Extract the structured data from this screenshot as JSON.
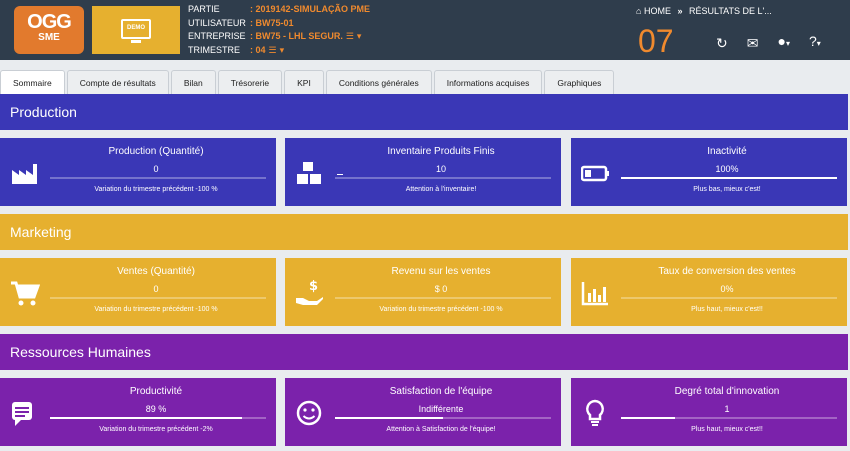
{
  "header": {
    "logo_line1": "OGG",
    "logo_line2": "SME",
    "demo_label": "DEMO",
    "rows": [
      {
        "label": "PARTIE",
        "value": ": 2019142-SIMULAÇÃO PME"
      },
      {
        "label": "UTILISATEUR",
        "value": ": BW75-01"
      },
      {
        "label": "ENTREPRISE",
        "value": ": BW75 - LHL SEGUR."
      },
      {
        "label": "TRIMESTRE",
        "value": ": 04"
      }
    ],
    "breadcrumb_home": "HOME",
    "breadcrumb_sep": "»",
    "breadcrumb_current": "RÉSULTATS DE L'...",
    "quarter_number": "07"
  },
  "tabs": [
    "Sommaire",
    "Compte de résultats",
    "Bilan",
    "Trésorerie",
    "KPI",
    "Conditions générales",
    "Informations acquises",
    "Graphiques"
  ],
  "colors": {
    "production": "#3a37b6",
    "marketing": "#e6b02f",
    "rh": "#7b22ab",
    "accent": "#f08a2e"
  },
  "sections": [
    {
      "title": "Production",
      "cards": [
        {
          "icon": "factory-icon",
          "title": "Production (Quantité)",
          "value": "0",
          "note": "Variation du trimestre précédent -100 %",
          "progress": 0
        },
        {
          "icon": "boxes-icon",
          "title": "Inventaire Produits Finis",
          "value": "10",
          "note": "Attention à l'inventaire!",
          "progress": 0
        },
        {
          "icon": "battery-icon",
          "title": "Inactivité",
          "value": "100%",
          "note": "Plus bas, mieux c'est!",
          "progress": 1.0
        }
      ]
    },
    {
      "title": "Marketing",
      "cards": [
        {
          "icon": "cart-icon",
          "title": "Ventes (Quantité)",
          "value": "0",
          "note": "Variation du trimestre précédent -100 %",
          "progress": 0
        },
        {
          "icon": "money-hand-icon",
          "title": "Revenu sur les ventes",
          "value": "$ 0",
          "note": "Variation du trimestre précédent -100 %",
          "progress": 0
        },
        {
          "icon": "bar-chart-icon",
          "title": "Taux de conversion des ventes",
          "value": "0%",
          "note": "Plus haut, mieux c'est!!",
          "progress": 0
        }
      ]
    },
    {
      "title": "Ressources Humaines",
      "cards": [
        {
          "icon": "comments-icon",
          "title": "Productivité",
          "value": "89 %",
          "note": "Variation du trimestre précédent -2%",
          "progress": 0.89
        },
        {
          "icon": "smile-icon",
          "title": "Satisfaction de l'équipe",
          "value": "Indifférente",
          "note": "Attention à Satisfaction de l'équipe!",
          "progress": 0.5
        },
        {
          "icon": "lightbulb-icon",
          "title": "Degré total d'innovation",
          "value": "1",
          "note": "Plus haut, mieux c'est!!",
          "progress": 0.25
        }
      ]
    }
  ]
}
